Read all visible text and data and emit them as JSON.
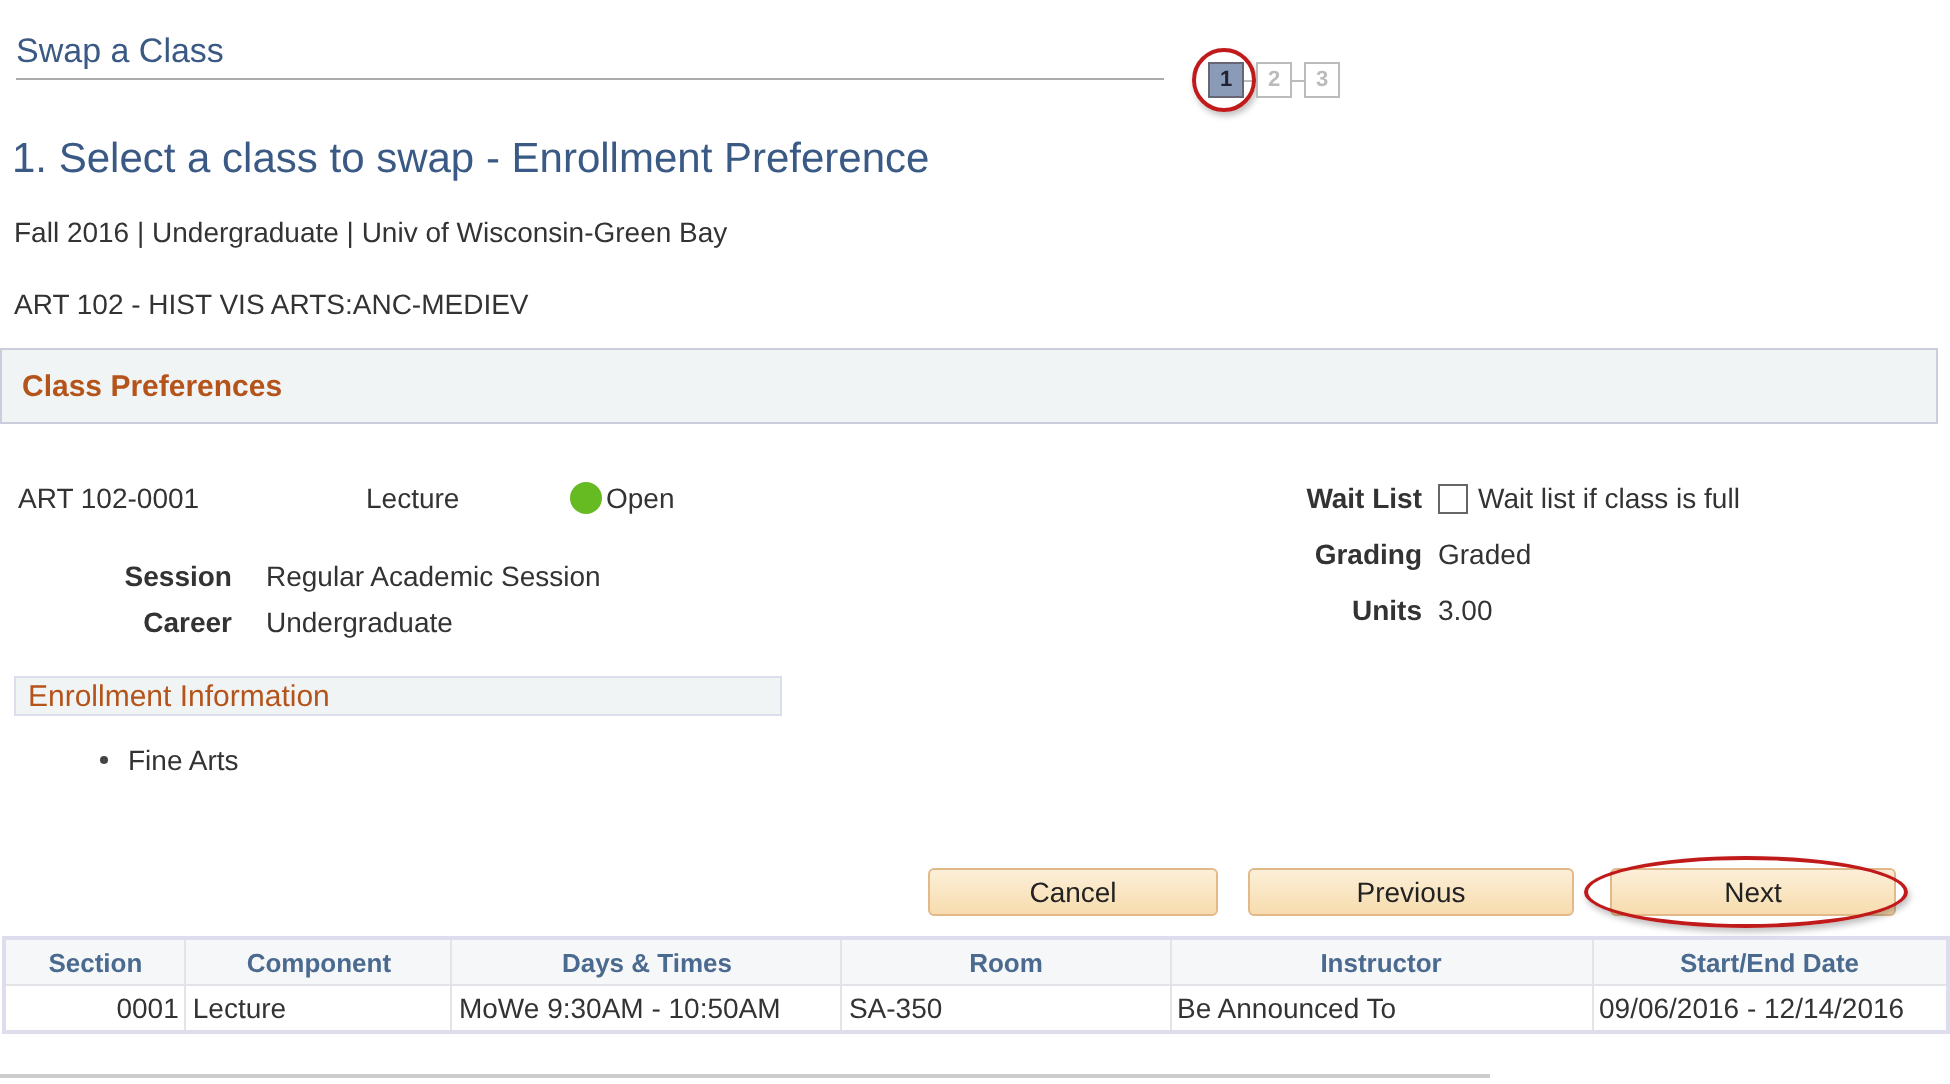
{
  "page_title": "Swap a Class",
  "steps": [
    {
      "label": "1",
      "selected": true,
      "highlighted": true
    },
    {
      "label": "2",
      "selected": false,
      "highlighted": false
    },
    {
      "label": "3",
      "selected": false,
      "highlighted": false
    }
  ],
  "heading": "1.  Select a class to swap - Enrollment Preference",
  "term_line": "Fall 2016 | Undergraduate | Univ of Wisconsin-Green Bay",
  "course_line": "ART  102 - HIST VIS ARTS:ANC-MEDIEV",
  "preferences": {
    "title": "Class Preferences",
    "class_number": "ART  102-0001",
    "component": "Lecture",
    "status": {
      "text": "Open",
      "kind": "open"
    },
    "left_fields": [
      {
        "label": "Session",
        "value": "Regular Academic Session"
      },
      {
        "label": "Career",
        "value": "Undergraduate"
      }
    ],
    "wait_list": {
      "label": "Wait List",
      "option": "Wait list if class is full",
      "checked": false
    },
    "right_fields": [
      {
        "label": "Grading",
        "value": "Graded"
      },
      {
        "label": "Units",
        "value": "3.00"
      }
    ]
  },
  "enrollment_info": {
    "title": "Enrollment Information",
    "items": [
      "Fine Arts"
    ]
  },
  "buttons": [
    {
      "label": "Cancel",
      "highlighted": false
    },
    {
      "label": "Previous",
      "highlighted": false
    },
    {
      "label": "Next",
      "highlighted": true
    }
  ],
  "table": {
    "columns": [
      "Section",
      "Component",
      "Days & Times",
      "Room",
      "Instructor",
      "Start/End Date"
    ],
    "rows": [
      [
        "0001",
        "Lecture",
        "MoWe 9:30AM - 10:50AM",
        "SA-350",
        "Be Announced To",
        "09/06/2016 - 12/14/2016"
      ]
    ]
  }
}
